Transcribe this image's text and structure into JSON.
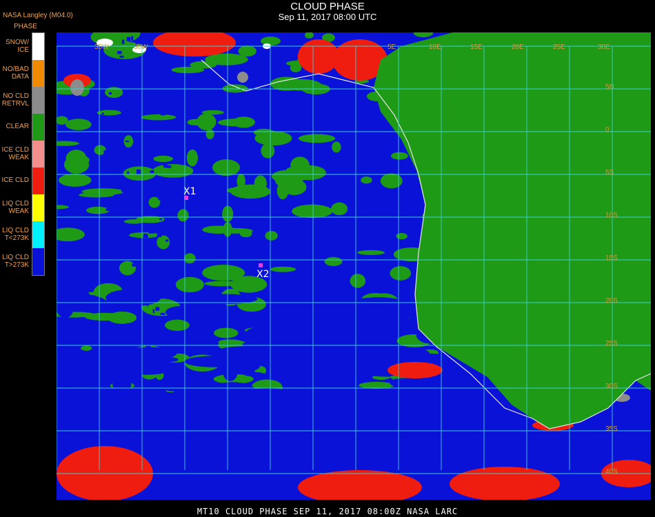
{
  "header": {
    "title": "CLOUD PHASE",
    "subtitle": "Sep 11, 2017 08:00 UTC",
    "org": "NASA Langley (M04.0)"
  },
  "legend": {
    "title": "PHASE",
    "items": [
      {
        "label": "SNOW/\nICE",
        "color": "#ffffff"
      },
      {
        "label": "NO/BAD\nDATA",
        "color": "#f08a00"
      },
      {
        "label": "NO CLD\nRETRVL",
        "color": "#8c8c8c"
      },
      {
        "label": "CLEAR",
        "color": "#1f9a17"
      },
      {
        "label": "ICE CLD\nWEAK",
        "color": "#f48e8e"
      },
      {
        "label": "ICE CLD",
        "color": "#ef1d10"
      },
      {
        "label": "LIQ CLD\nWEAK",
        "color": "#ffff00"
      },
      {
        "label": "LIQ CLD\nT<273K",
        "color": "#00f0ff"
      },
      {
        "label": "LIQ CLD\nT>273K",
        "color": "#0a12d8"
      }
    ]
  },
  "map": {
    "graticule_color": "#3ccfd0",
    "coast_color": "#e6e6e6",
    "lon_labels": [
      "35W",
      "30W",
      "5E",
      "10E",
      "15E",
      "20E",
      "25E",
      "30E"
    ],
    "lat_labels": [
      "5N",
      "0",
      "5S",
      "10S",
      "15S",
      "20S",
      "25S",
      "30S",
      "35S",
      "40S"
    ],
    "markers": [
      {
        "label": "X1",
        "color": "#e040e0"
      },
      {
        "label": "X2",
        "color": "#e040e0"
      }
    ]
  },
  "footer": {
    "text": "MT10  CLOUD PHASE   SEP 11, 2017 08:00Z   NASA LARC"
  }
}
